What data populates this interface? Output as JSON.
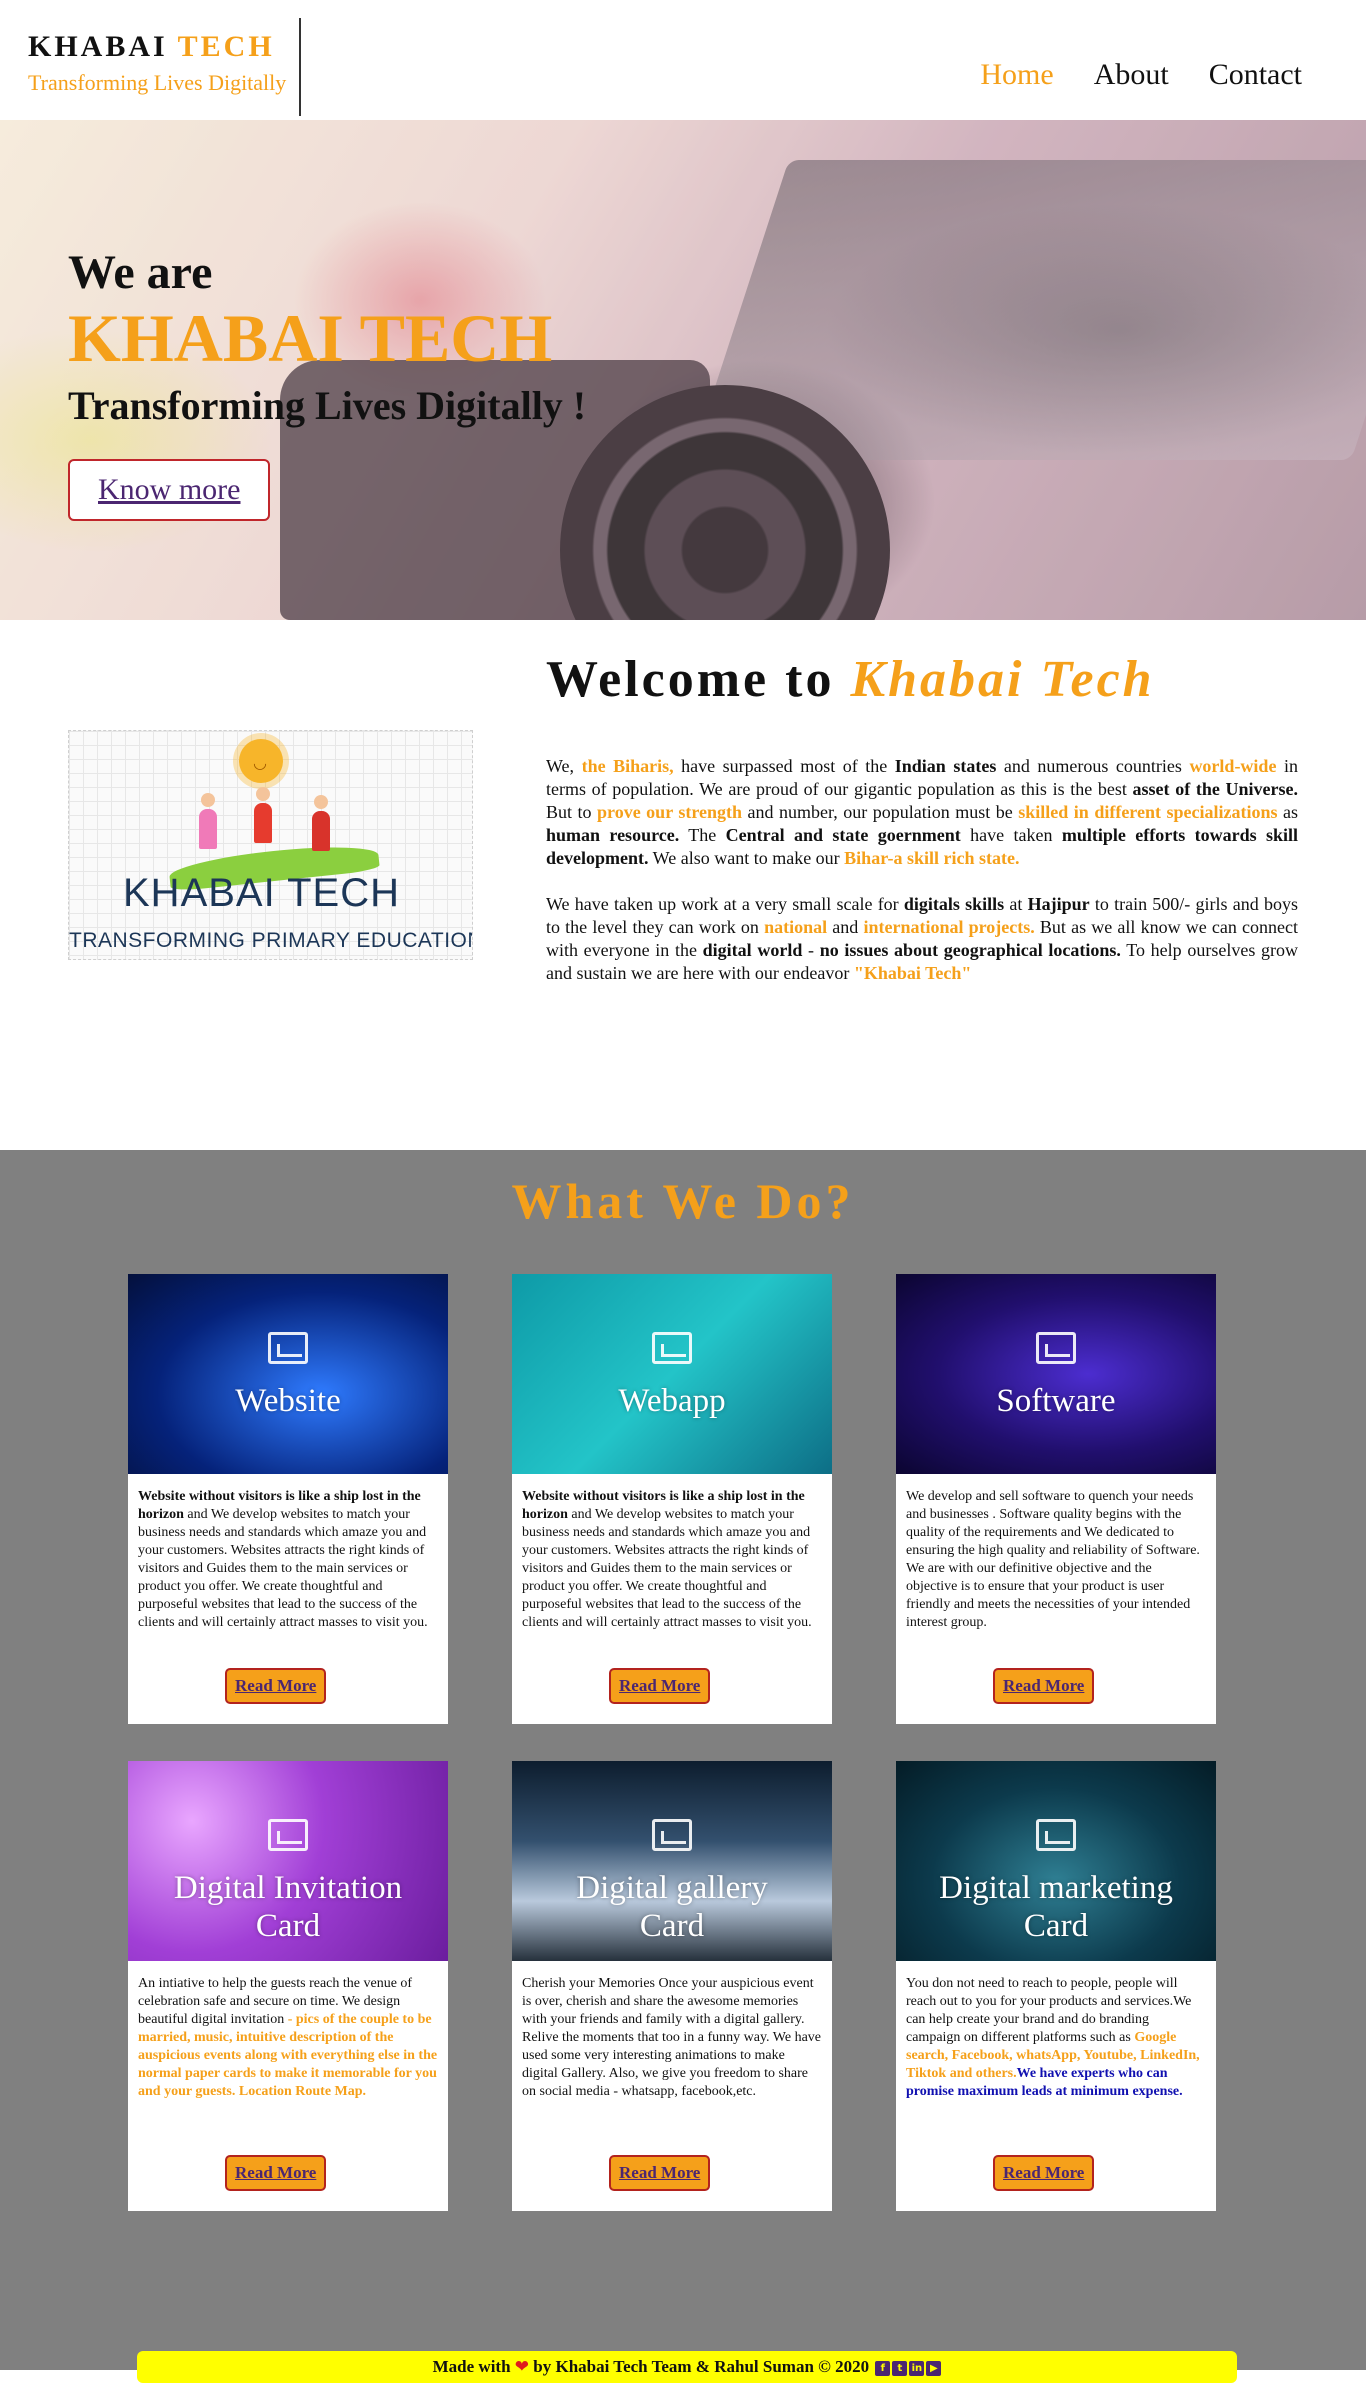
{
  "header": {
    "brand_main": "KHABAI",
    "brand_accent": "TECH",
    "tagline": "Transforming Lives Digitally",
    "nav": [
      "Home",
      "About",
      "Contact"
    ]
  },
  "hero": {
    "kicker": "We are",
    "title": "KHABAI TECH",
    "subtitle": "Transforming Lives Digitally !",
    "button": "Know more"
  },
  "about": {
    "title_prefix": "Welcome to",
    "title_accent": "Khabai Tech",
    "logo_text": "KHABAI TECH",
    "logo_sub": "TRANSFORMING PRIMARY EDUCATION",
    "p1": {
      "a": "We, ",
      "b": "the Biharis,",
      "c": " have surpassed most of the ",
      "d": "Indian states",
      "e": " and numerous countries ",
      "f": "world-wide",
      "g": " in terms of population. We are proud of our gigantic population as this is the best ",
      "h": "asset of the Universe.",
      "i": " But to ",
      "j": "prove our strength",
      "k": " and number, our population must be ",
      "l": "skilled in different specializations",
      "m": " as ",
      "n": "human resource.",
      "o": " The ",
      "p": "Central and state goernment",
      "q": " have taken ",
      "r": "multiple efforts towards skill development.",
      "s": " We also want to make our ",
      "t": "Bihar-a skill rich state."
    },
    "p2": {
      "a": "We have taken up work at a very small scale for ",
      "b": "digitals skills",
      "c": " at ",
      "d": "Hajipur",
      "e": " to train 500/- girls and boys to the level they can work on ",
      "f": "national",
      "g": " and ",
      "h": "international projects.",
      "i": " But as we all know we can connect with everyone in the ",
      "j": "digital world",
      "k": " - ",
      "l": "no issues about geographical locations.",
      "m": " To help ourselves grow and sustain we are here with our endeavor ",
      "n": "\"Khabai Tech\""
    }
  },
  "services": {
    "title": "What We Do?",
    "read_more": "Read More",
    "cards": [
      {
        "label": "Website",
        "bold": "Website without visitors is like a ship lost in the horizon",
        "text": " and We develop websites to match your business needs and standards which amaze you and your customers. Websites attracts the right kinds of visitors and Guides them to the main services or product you offer. We create thoughtful and purposeful websites that lead to the success of the clients and will certainly attract masses to visit you."
      },
      {
        "label": "Webapp",
        "bold": "Website without visitors is like a ship lost in the horizon",
        "text": " and We develop websites to match your business needs and standards which amaze you and your customers. Websites attracts the right kinds of visitors and Guides them to the main services or product you offer. We create thoughtful and purposeful websites that lead to the success of the clients and will certainly attract masses to visit you."
      },
      {
        "label": "Software",
        "text": "We develop and sell software to quench your needs and businesses . Software quality begins with the quality of the requirements and We dedicated to ensuring the high quality and reliability of Software. We are with our definitive objective and the objective is to ensure that your product is user friendly and meets the necessities of your intended interest group."
      },
      {
        "label_1": "Digital Invitation",
        "label_2": "Card",
        "text": "An intiative to help the guests reach the venue of celebration safe and secure on time. We design beautiful digital invitation ",
        "orange": "- pics of the couple to be married, music, intuitive description of the auspicious events along with everything else in the normal paper cards to make it memorable for you and your guests. Location Route Map."
      },
      {
        "label_1": "Digital gallery",
        "label_2": "Card",
        "text": "Cherish your Memories Once your auspicious event is over, cherish and share the awesome memories with your friends and family with a digital gallery. Relive the moments that too in a funny way. We have used some very interesting animations to make digital Gallery. Also, we give you freedom to share on social media - whatsapp, facebook,etc."
      },
      {
        "label_1": "Digital marketing",
        "label_2": "Card",
        "text": "You don not need to reach to people, people will reach out to you for your products and services.We can help create your brand and do branding campaign on different platforms such as ",
        "orange": "Google search, Facebook, whatsApp, Youtube, LinkedIn, Tiktok and others.",
        "blue": "We have experts who can promise maximum leads at minimum expense."
      }
    ]
  },
  "footer": {
    "made_with": "Made with",
    "by": "by Khabai Tech Team & Rahul Suman",
    "copyright": "©",
    "year": "2020"
  },
  "colors": {
    "accent": "#f5a01a",
    "services_bg": "#808080",
    "footer_bg": "#ffff00",
    "button_text": "#4b2671"
  },
  "icons": [
    "heart-icon",
    "facebook-icon",
    "twitter-icon",
    "linkedin-icon",
    "youtube-icon",
    "image-icon"
  ]
}
